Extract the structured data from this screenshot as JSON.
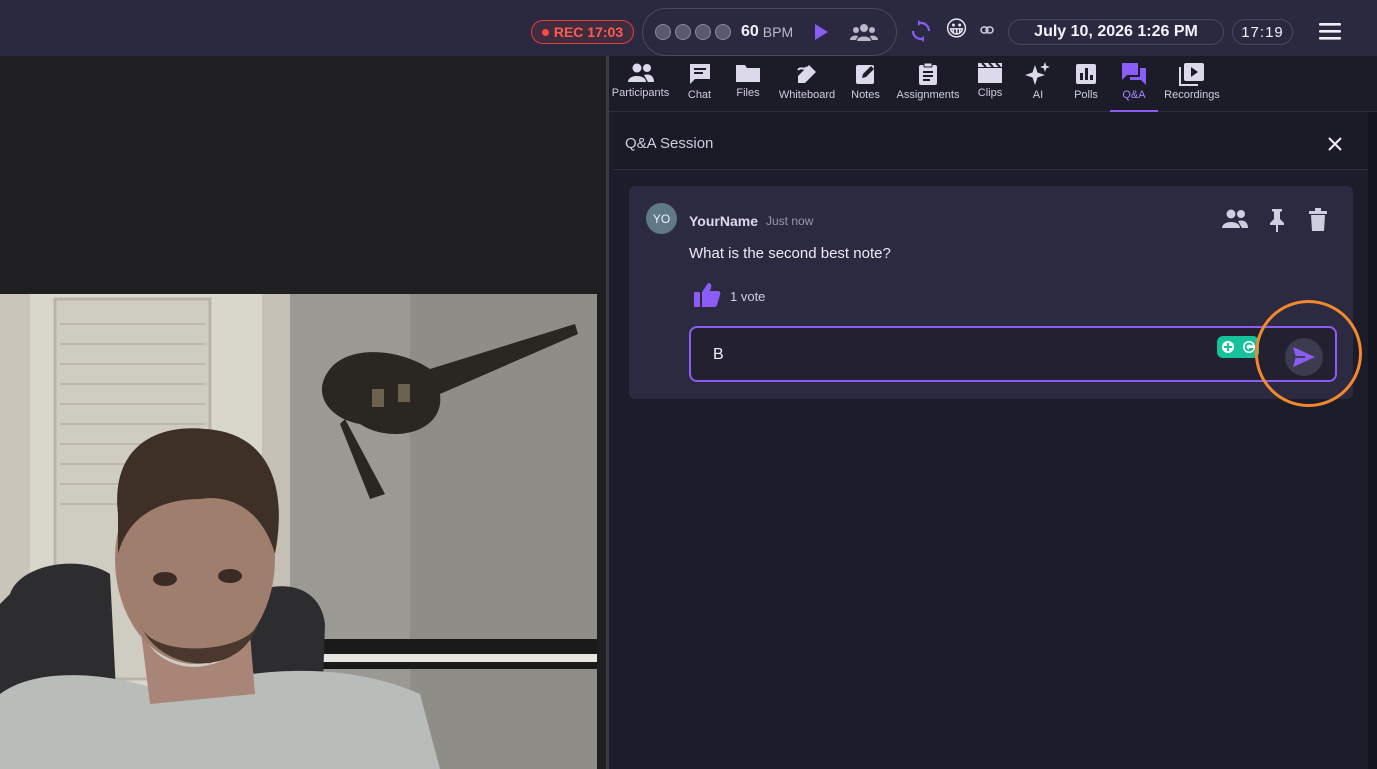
{
  "topbar": {
    "rec_label": "REC 17:03",
    "bpm_value": "60",
    "bpm_unit": "BPM",
    "emoji": "😀",
    "datetime": "July 10, 2026 1:26 PM",
    "clock": "17:19",
    "icons": [
      "play-icon",
      "people-icon",
      "sync-icon",
      "link-icon",
      "menu-icon"
    ],
    "accent": "#8b5cf6",
    "rec_color": "#ff5a52"
  },
  "tabs": [
    {
      "label": "Participants",
      "icon": "participants-icon"
    },
    {
      "label": "Chat",
      "icon": "chat-icon"
    },
    {
      "label": "Files",
      "icon": "folder-icon"
    },
    {
      "label": "Whiteboard",
      "icon": "whiteboard-icon"
    },
    {
      "label": "Notes",
      "icon": "notes-icon"
    },
    {
      "label": "Assignments",
      "icon": "assignments-icon"
    },
    {
      "label": "Clips",
      "icon": "clips-icon"
    },
    {
      "label": "AI",
      "icon": "ai-sparkle-icon"
    },
    {
      "label": "Polls",
      "icon": "polls-icon"
    },
    {
      "label": "Q&A",
      "icon": "qa-icon",
      "active": true
    },
    {
      "label": "Recordings",
      "icon": "recordings-icon"
    }
  ],
  "session": {
    "title": "Q&A Session"
  },
  "question": {
    "avatar": "YO",
    "author": "YourName",
    "time": "Just now",
    "text": "What is the second best note?",
    "votes": "1 vote",
    "reply_value": "B"
  }
}
